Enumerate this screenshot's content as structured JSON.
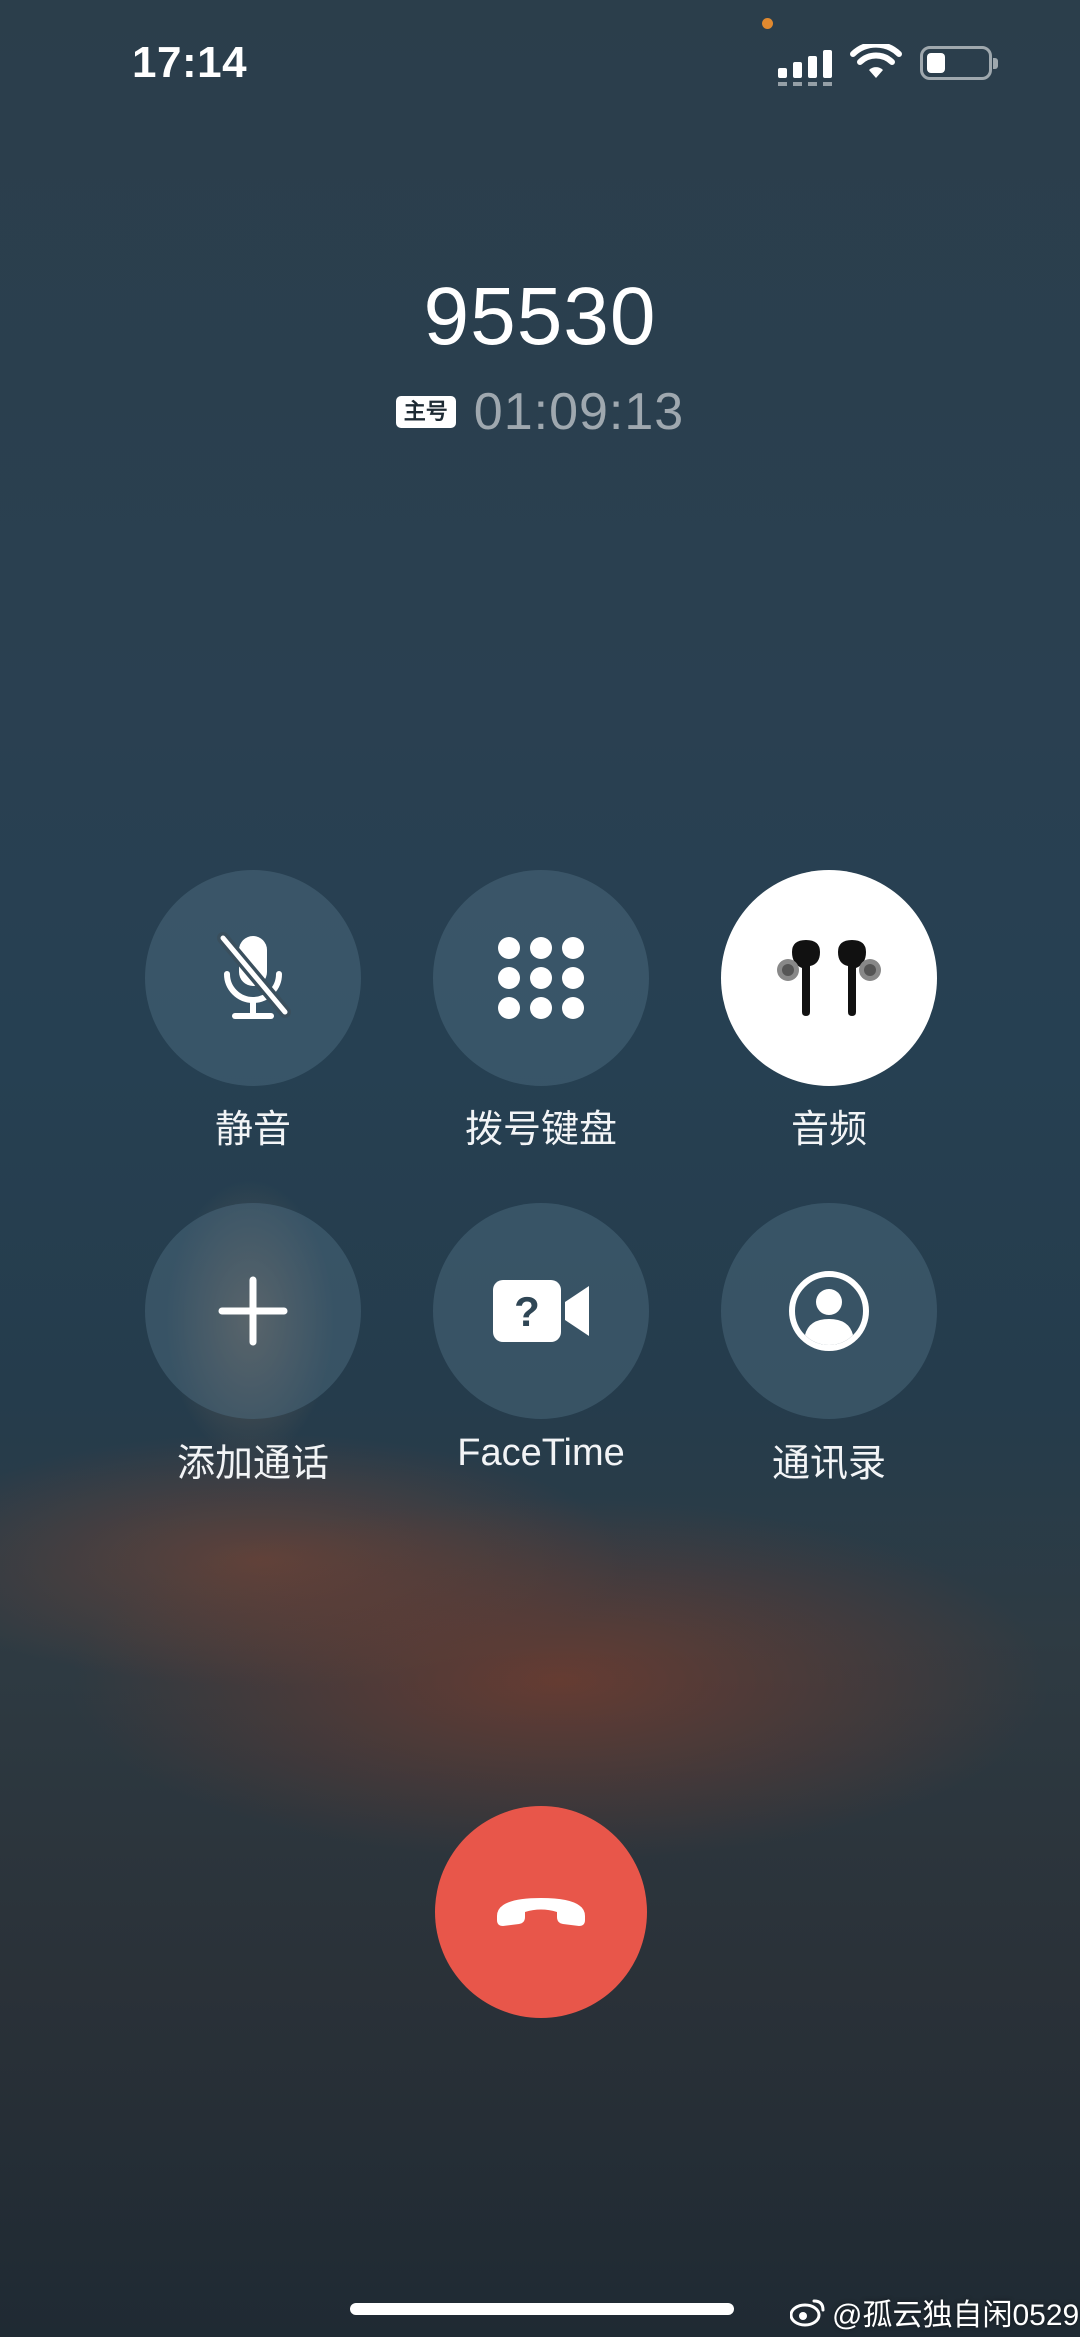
{
  "status_bar": {
    "time": "17:14",
    "privacy_dot_color": "#e0892f"
  },
  "call": {
    "number": "95530",
    "line_badge": "主号",
    "duration": "01:09:13"
  },
  "controls": [
    {
      "id": "mute",
      "label": "静音",
      "icon": "mic-slash-icon",
      "active": false
    },
    {
      "id": "keypad",
      "label": "拨号键盘",
      "icon": "keypad-icon",
      "active": false
    },
    {
      "id": "audio",
      "label": "音频",
      "icon": "airpods-icon",
      "active": true
    },
    {
      "id": "add-call",
      "label": "添加通话",
      "icon": "plus-icon",
      "active": false
    },
    {
      "id": "facetime",
      "label": "FaceTime",
      "icon": "facetime-unavailable-icon",
      "active": false
    },
    {
      "id": "contacts",
      "label": "通讯录",
      "icon": "person-circle-icon",
      "active": false
    }
  ],
  "end_call": {
    "icon": "phone-down-icon",
    "color": "#e8564a"
  },
  "watermark": {
    "text": "@孤云独自闲0529",
    "icon": "weibo-icon"
  }
}
